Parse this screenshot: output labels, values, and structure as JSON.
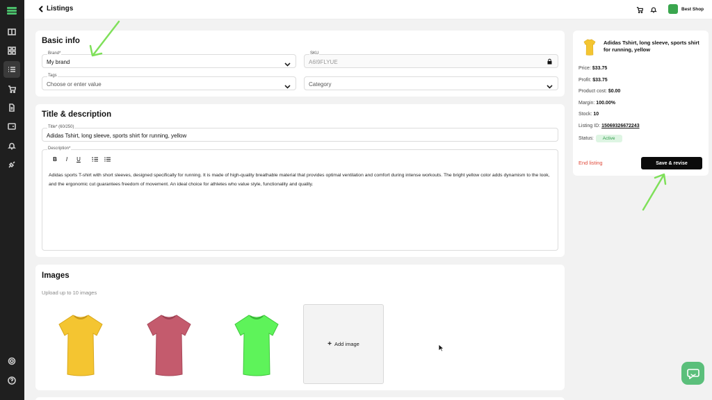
{
  "header": {
    "title": "Listings",
    "shop_name": "Best Shop"
  },
  "sidebar": {
    "items": [
      "book-icon",
      "grid-icon",
      "list-icon",
      "cart-icon",
      "document-icon",
      "wallet-icon",
      "bell-icon",
      "plug-icon",
      "settings-icon",
      "help-icon"
    ]
  },
  "basic_info": {
    "title": "Basic info",
    "brand": {
      "label": "Brand*",
      "value": "My brand"
    },
    "sku": {
      "label": "SKU",
      "value": "A6I9FLYUE"
    },
    "tags": {
      "label": "Tags",
      "placeholder": "Choose or enter value"
    },
    "category": {
      "placeholder": "Category"
    }
  },
  "title_desc": {
    "title": "Title & description",
    "title_field": {
      "label": "Title* (60/250)",
      "value": "Adidas Tshirt, long sleeve, sports shirt for running, yellow"
    },
    "description": {
      "label": "Description*",
      "toolbar": [
        "B",
        "I",
        "U"
      ],
      "text": "Adidas sports T-shirt with short sleeves, designed specifically for running. It is made of high-quality breathable material that provides optimal ventilation and comfort during intense workouts. The bright yellow color adds dynamism to the look, and the ergonomic cut guarantees freedom of movement. An ideal choice for athletes who value style, functionality and quality."
    }
  },
  "images": {
    "title": "Images",
    "hint": "Upload up to 10 images",
    "add_label": "Add image",
    "colors": [
      "#f4c531",
      "#c45b6d",
      "#5ef35a"
    ]
  },
  "summary": {
    "product_title": "Adidas Tshirt, long sleeve, sports shirt for running, yellow",
    "price_label": "Price:",
    "price": "$33.75",
    "profit_label": "Profit:",
    "profit": "$33.75",
    "cost_label": "Product cost:",
    "cost": "$0.00",
    "margin_label": "Margin:",
    "margin": "100.00%",
    "stock_label": "Stock:",
    "stock": "10",
    "listing_id_label": "Listing ID:",
    "listing_id": "15069326672243",
    "status_label": "Status:",
    "status": "Active",
    "end_label": "End listing",
    "save_label": "Save & revise"
  },
  "colors": {
    "accent": "#3aa64e",
    "danger": "#e04a3a",
    "arrow": "#7fe05a"
  }
}
